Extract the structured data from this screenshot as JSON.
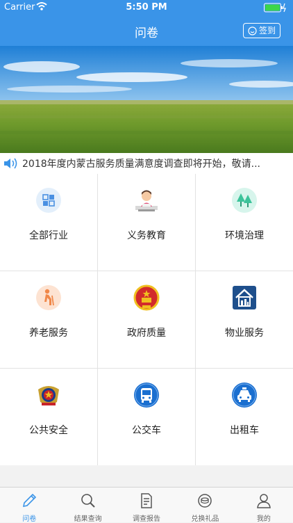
{
  "status_bar": {
    "carrier": "Carrier",
    "time": "5:50 PM"
  },
  "nav": {
    "title": "问卷",
    "checkin_label": "签到"
  },
  "ticker": {
    "text": "2018年度内蒙古服务质量满意度调查即将开始，敬请..."
  },
  "categories": [
    {
      "label": "全部行业",
      "icon": "grid-icon",
      "color": "#4a90e2"
    },
    {
      "label": "义务教育",
      "icon": "student-icon",
      "color": "#e07a4a"
    },
    {
      "label": "环境治理",
      "icon": "trees-icon",
      "color": "#3cc39a"
    },
    {
      "label": "养老服务",
      "icon": "elderly-icon",
      "color": "#f0884a"
    },
    {
      "label": "政府质量",
      "icon": "national-emblem-icon",
      "color": "#d22b2b"
    },
    {
      "label": "物业服务",
      "icon": "property-building-icon",
      "color": "#1e4f8c"
    },
    {
      "label": "公共安全",
      "icon": "police-badge-icon",
      "color": "#c8242a"
    },
    {
      "label": "公交车",
      "icon": "bus-icon",
      "color": "#1a6fd0"
    },
    {
      "label": "出租车",
      "icon": "taxi-icon",
      "color": "#1a6fd0"
    }
  ],
  "tabs": [
    {
      "label": "问卷",
      "icon": "pencil-icon",
      "active": true
    },
    {
      "label": "结果查询",
      "icon": "search-icon",
      "active": false
    },
    {
      "label": "调查报告",
      "icon": "document-icon",
      "active": false
    },
    {
      "label": "兑换礼品",
      "icon": "coins-icon",
      "active": false
    },
    {
      "label": "我的",
      "icon": "person-icon",
      "active": false
    }
  ],
  "colors": {
    "primary": "#3a94e8",
    "tab_inactive": "#666666"
  }
}
